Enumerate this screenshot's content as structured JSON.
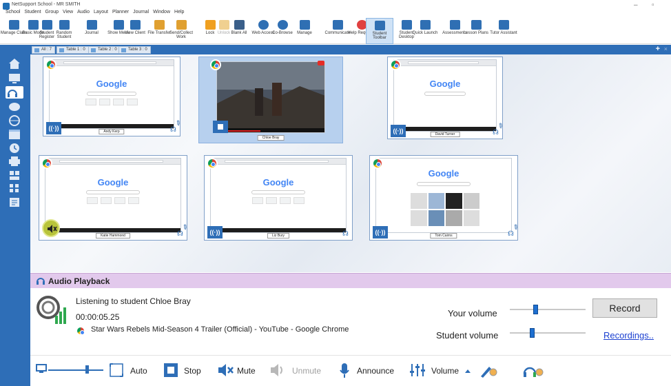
{
  "window": {
    "title": "NetSupport School - MR SMITH",
    "controls": [
      "–",
      "▫"
    ]
  },
  "menu": [
    "School",
    "Student",
    "Group",
    "View",
    "Audio",
    "Layout",
    "Planner",
    "Journal",
    "Window",
    "Help"
  ],
  "toolbar": [
    {
      "label": "Manage Class",
      "color": "#2f6fb3"
    },
    {
      "label": "Basic Mode",
      "color": "#2f6fb3"
    },
    {
      "label": "Student Register",
      "color": "#2f6fb3"
    },
    {
      "label": "Random Student",
      "color": "#2f6fb3"
    },
    {
      "label": "Journal",
      "color": "#2f6fb3"
    },
    {
      "label": "Show Menu",
      "color": "#2f6fb3"
    },
    {
      "label": "View Client",
      "color": "#2f6fb3"
    },
    {
      "label": "File Transfer",
      "color": "#e0a030"
    },
    {
      "label": "Send/Collect Work",
      "color": "#e0a030"
    },
    {
      "label": "Lock",
      "color": "#f0a020"
    },
    {
      "label": "Unlock",
      "color": "#f0d090"
    },
    {
      "label": "Blank All",
      "color": "#3a5f8a"
    },
    {
      "label": "Web Access",
      "color": "#2f6fb3"
    },
    {
      "label": "Co-Browse",
      "color": "#2f6fb3"
    },
    {
      "label": "Manage",
      "color": "#2f6fb3"
    },
    {
      "label": "Communicate",
      "color": "#2f6fb3"
    },
    {
      "label": "Help Requests",
      "color": "#e04040"
    },
    {
      "label": "Student Toolbar",
      "color": "#2f6fb3"
    },
    {
      "label": "Student Desktop",
      "color": "#2f6fb3"
    },
    {
      "label": "Quick Launch",
      "color": "#2f6fb3"
    },
    {
      "label": "Assessments",
      "color": "#2f6fb3"
    },
    {
      "label": "Lesson Plans",
      "color": "#2f6fb3"
    },
    {
      "label": "Tutor Assistant",
      "color": "#2f6fb3"
    }
  ],
  "tabs": [
    {
      "label": "All : 7"
    },
    {
      "label": "Table 1 : 0"
    },
    {
      "label": "Table 2 : 0"
    },
    {
      "label": "Table 3 : 0"
    }
  ],
  "tabs_actions": {
    "add": "+",
    "close": "×"
  },
  "students": [
    {
      "name": "Andy Kerp",
      "content": "google"
    },
    {
      "name": "Chloe Bray",
      "content": "video"
    },
    {
      "name": "David Turner",
      "content": "google"
    },
    {
      "name": "Katie Hammond",
      "content": "google"
    },
    {
      "name": "Liz Bury",
      "content": "google"
    },
    {
      "name": "Tom Cairns",
      "content": "google-tiles"
    }
  ],
  "screen_text": {
    "google": "Google"
  },
  "audio_panel": {
    "title": "Audio Playback",
    "listening": "Listening to student Chloe Bray",
    "timer": "00:00:05.25",
    "page_title": "Star Wars Rebels Mid-Season 4 Trailer (Official) - YouTube - Google Chrome",
    "your_volume_label": "Your volume",
    "your_volume_level": 0.33,
    "student_volume_label": "Student volume",
    "student_volume_level": 0.28,
    "record_label": "Record",
    "recordings_label": "Recordings.."
  },
  "bottom_toolbar": {
    "auto": "Auto",
    "stop": "Stop",
    "mute": "Mute",
    "unmute": "Unmute",
    "announce": "Announce",
    "volume": "Volume"
  },
  "colors": {
    "accent": "#2e6eb7",
    "audio_header": "#e2c9ec",
    "record_link": "#1a3fd0"
  }
}
